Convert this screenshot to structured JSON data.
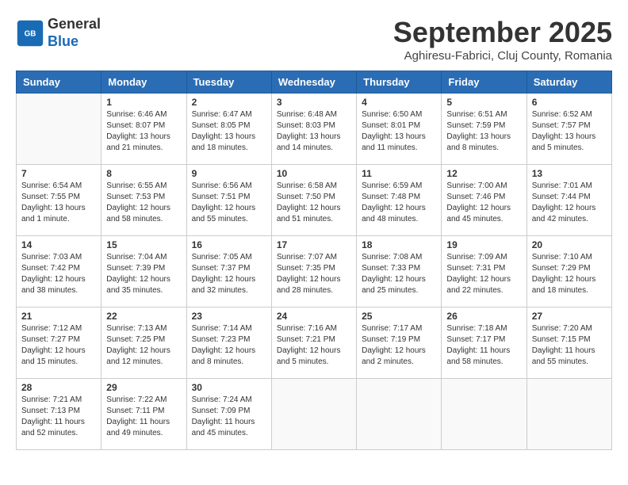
{
  "logo": {
    "line1": "General",
    "line2": "Blue"
  },
  "title": "September 2025",
  "location": "Aghiresu-Fabrici, Cluj County, Romania",
  "days_of_week": [
    "Sunday",
    "Monday",
    "Tuesday",
    "Wednesday",
    "Thursday",
    "Friday",
    "Saturday"
  ],
  "weeks": [
    [
      {
        "day": "",
        "info": ""
      },
      {
        "day": "1",
        "info": "Sunrise: 6:46 AM\nSunset: 8:07 PM\nDaylight: 13 hours\nand 21 minutes."
      },
      {
        "day": "2",
        "info": "Sunrise: 6:47 AM\nSunset: 8:05 PM\nDaylight: 13 hours\nand 18 minutes."
      },
      {
        "day": "3",
        "info": "Sunrise: 6:48 AM\nSunset: 8:03 PM\nDaylight: 13 hours\nand 14 minutes."
      },
      {
        "day": "4",
        "info": "Sunrise: 6:50 AM\nSunset: 8:01 PM\nDaylight: 13 hours\nand 11 minutes."
      },
      {
        "day": "5",
        "info": "Sunrise: 6:51 AM\nSunset: 7:59 PM\nDaylight: 13 hours\nand 8 minutes."
      },
      {
        "day": "6",
        "info": "Sunrise: 6:52 AM\nSunset: 7:57 PM\nDaylight: 13 hours\nand 5 minutes."
      }
    ],
    [
      {
        "day": "7",
        "info": "Sunrise: 6:54 AM\nSunset: 7:55 PM\nDaylight: 13 hours\nand 1 minute."
      },
      {
        "day": "8",
        "info": "Sunrise: 6:55 AM\nSunset: 7:53 PM\nDaylight: 12 hours\nand 58 minutes."
      },
      {
        "day": "9",
        "info": "Sunrise: 6:56 AM\nSunset: 7:51 PM\nDaylight: 12 hours\nand 55 minutes."
      },
      {
        "day": "10",
        "info": "Sunrise: 6:58 AM\nSunset: 7:50 PM\nDaylight: 12 hours\nand 51 minutes."
      },
      {
        "day": "11",
        "info": "Sunrise: 6:59 AM\nSunset: 7:48 PM\nDaylight: 12 hours\nand 48 minutes."
      },
      {
        "day": "12",
        "info": "Sunrise: 7:00 AM\nSunset: 7:46 PM\nDaylight: 12 hours\nand 45 minutes."
      },
      {
        "day": "13",
        "info": "Sunrise: 7:01 AM\nSunset: 7:44 PM\nDaylight: 12 hours\nand 42 minutes."
      }
    ],
    [
      {
        "day": "14",
        "info": "Sunrise: 7:03 AM\nSunset: 7:42 PM\nDaylight: 12 hours\nand 38 minutes."
      },
      {
        "day": "15",
        "info": "Sunrise: 7:04 AM\nSunset: 7:39 PM\nDaylight: 12 hours\nand 35 minutes."
      },
      {
        "day": "16",
        "info": "Sunrise: 7:05 AM\nSunset: 7:37 PM\nDaylight: 12 hours\nand 32 minutes."
      },
      {
        "day": "17",
        "info": "Sunrise: 7:07 AM\nSunset: 7:35 PM\nDaylight: 12 hours\nand 28 minutes."
      },
      {
        "day": "18",
        "info": "Sunrise: 7:08 AM\nSunset: 7:33 PM\nDaylight: 12 hours\nand 25 minutes."
      },
      {
        "day": "19",
        "info": "Sunrise: 7:09 AM\nSunset: 7:31 PM\nDaylight: 12 hours\nand 22 minutes."
      },
      {
        "day": "20",
        "info": "Sunrise: 7:10 AM\nSunset: 7:29 PM\nDaylight: 12 hours\nand 18 minutes."
      }
    ],
    [
      {
        "day": "21",
        "info": "Sunrise: 7:12 AM\nSunset: 7:27 PM\nDaylight: 12 hours\nand 15 minutes."
      },
      {
        "day": "22",
        "info": "Sunrise: 7:13 AM\nSunset: 7:25 PM\nDaylight: 12 hours\nand 12 minutes."
      },
      {
        "day": "23",
        "info": "Sunrise: 7:14 AM\nSunset: 7:23 PM\nDaylight: 12 hours\nand 8 minutes."
      },
      {
        "day": "24",
        "info": "Sunrise: 7:16 AM\nSunset: 7:21 PM\nDaylight: 12 hours\nand 5 minutes."
      },
      {
        "day": "25",
        "info": "Sunrise: 7:17 AM\nSunset: 7:19 PM\nDaylight: 12 hours\nand 2 minutes."
      },
      {
        "day": "26",
        "info": "Sunrise: 7:18 AM\nSunset: 7:17 PM\nDaylight: 11 hours\nand 58 minutes."
      },
      {
        "day": "27",
        "info": "Sunrise: 7:20 AM\nSunset: 7:15 PM\nDaylight: 11 hours\nand 55 minutes."
      }
    ],
    [
      {
        "day": "28",
        "info": "Sunrise: 7:21 AM\nSunset: 7:13 PM\nDaylight: 11 hours\nand 52 minutes."
      },
      {
        "day": "29",
        "info": "Sunrise: 7:22 AM\nSunset: 7:11 PM\nDaylight: 11 hours\nand 49 minutes."
      },
      {
        "day": "30",
        "info": "Sunrise: 7:24 AM\nSunset: 7:09 PM\nDaylight: 11 hours\nand 45 minutes."
      },
      {
        "day": "",
        "info": ""
      },
      {
        "day": "",
        "info": ""
      },
      {
        "day": "",
        "info": ""
      },
      {
        "day": "",
        "info": ""
      }
    ]
  ]
}
